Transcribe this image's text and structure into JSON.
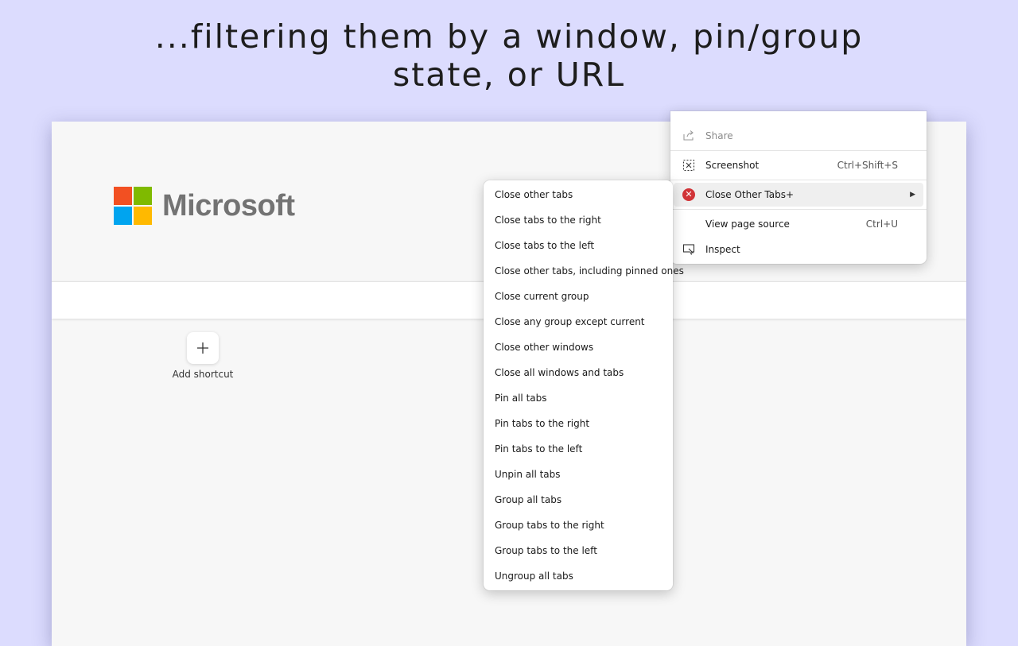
{
  "headline": {
    "line1": "...filtering them by a window, pin/group",
    "line2": "state, or URL"
  },
  "newtab": {
    "logo_text": "Microsoft",
    "logo_colors": [
      "#f25022",
      "#7fba00",
      "#00a4ef",
      "#ffb900"
    ],
    "add_shortcut_label": "Add shortcut"
  },
  "browser_menu": {
    "items": [
      {
        "label": "Share",
        "icon": "share-icon",
        "shortcut": "",
        "disabled": true
      },
      {
        "label": "Screenshot",
        "icon": "screenshot-icon",
        "shortcut": "Ctrl+Shift+S"
      },
      {
        "label": "Close Other Tabs+",
        "icon": "extension-close-icon",
        "shortcut": "",
        "has_submenu": true,
        "highlighted": true
      },
      {
        "label": "View page source",
        "icon": "",
        "shortcut": "Ctrl+U"
      },
      {
        "label": "Inspect",
        "icon": "inspect-icon",
        "shortcut": ""
      }
    ],
    "accent_color": "#d13438"
  },
  "submenu": {
    "items": [
      "Close other tabs",
      "Close tabs to the right",
      "Close tabs to the left",
      "Close other tabs, including pinned ones",
      "Close current group",
      "Close any group except current",
      "Close other windows",
      "Close all windows and tabs",
      "Pin all tabs",
      "Pin tabs to the right",
      "Pin tabs to the left",
      "Unpin all tabs",
      "Group all tabs",
      "Group tabs to the right",
      "Group tabs to the left",
      "Ungroup all tabs"
    ]
  }
}
